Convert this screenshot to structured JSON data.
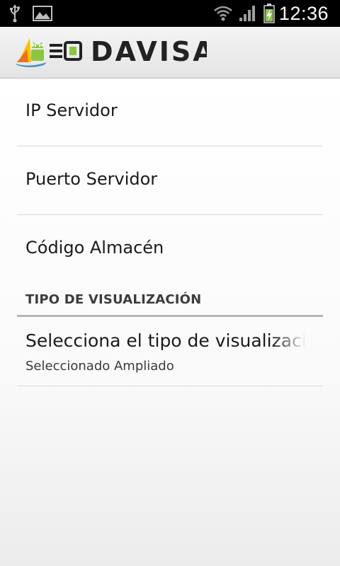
{
  "status_bar": {
    "time": "12:36",
    "icons": [
      "usb-icon",
      "gallery-icon",
      "wifi-icon",
      "signal-icon",
      "battery-charging-icon"
    ]
  },
  "action_bar": {
    "brand": "DAVISA",
    "logo_icon": "app-logo-icon"
  },
  "preferences": {
    "items": [
      {
        "title": "IP Servidor"
      },
      {
        "title": "Puerto Servidor"
      },
      {
        "title": "Código Almacén"
      }
    ],
    "category": {
      "title": "TIPO DE VISUALIZACIÓN",
      "list_preference": {
        "title": "Selecciona el tipo de visualización",
        "summary": "Seleccionado Ampliado"
      }
    }
  },
  "colors": {
    "status_bar": "#000000",
    "battery_charging": "#8bc34a",
    "logo_green": "#8cc63f",
    "logo_yellow": "#f6c000",
    "logo_orange": "#e8731a",
    "text_primary": "#1a1a1a",
    "category_text": "#3c3c3c"
  }
}
